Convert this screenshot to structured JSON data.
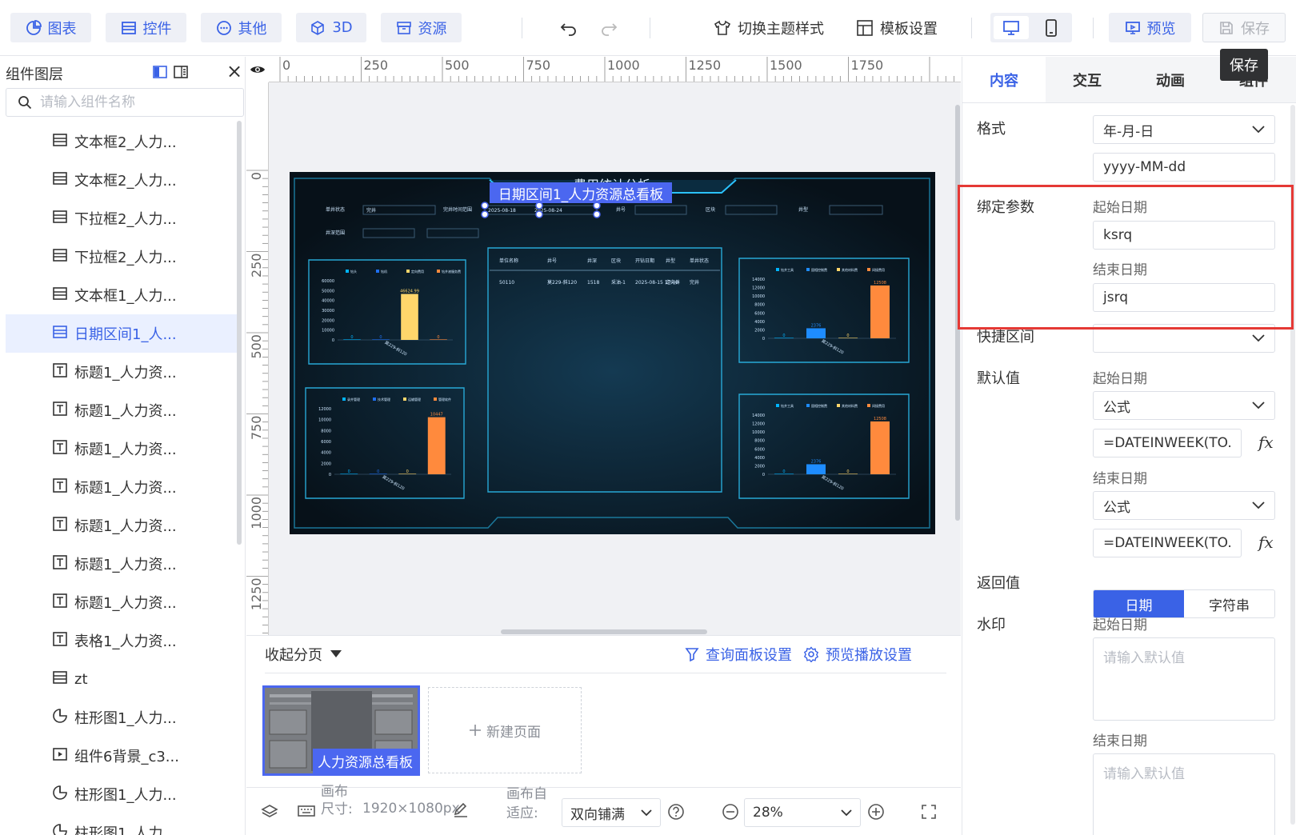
{
  "toolbar": {
    "chart_label": "图表",
    "widget_label": "控件",
    "other_label": "其他",
    "three_d_label": "3D",
    "resource_label": "资源",
    "theme_label": "切换主题样式",
    "template_label": "模板设置",
    "preview_label": "预览",
    "save_label": "保存",
    "save_tooltip": "保存"
  },
  "left_panel": {
    "title": "组件图层",
    "search_placeholder": "请输入组件名称",
    "items": [
      {
        "label": "文本框2_人力...",
        "icon": "textbox-icon"
      },
      {
        "label": "文本框2_人力...",
        "icon": "textbox-icon"
      },
      {
        "label": "下拉框2_人力...",
        "icon": "dropdown-icon"
      },
      {
        "label": "下拉框2_人力...",
        "icon": "dropdown-icon"
      },
      {
        "label": "文本框1_人力...",
        "icon": "textbox-icon"
      },
      {
        "label": "日期区间1_人...",
        "icon": "daterange-icon",
        "active": true
      },
      {
        "label": "标题1_人力资...",
        "icon": "title-icon"
      },
      {
        "label": "标题1_人力资...",
        "icon": "title-icon"
      },
      {
        "label": "标题1_人力资...",
        "icon": "title-icon"
      },
      {
        "label": "标题1_人力资...",
        "icon": "title-icon"
      },
      {
        "label": "标题1_人力资...",
        "icon": "title-icon"
      },
      {
        "label": "标题1_人力资...",
        "icon": "title-icon"
      },
      {
        "label": "标题1_人力资...",
        "icon": "title-icon"
      },
      {
        "label": "表格1_人力资...",
        "icon": "title-icon"
      },
      {
        "label": "zt",
        "icon": "textbox-icon"
      },
      {
        "label": "柱形图1_人力...",
        "icon": "pie-chart-icon"
      },
      {
        "label": "组件6背景_c3...",
        "icon": "play-icon"
      },
      {
        "label": "柱形图1_人力...",
        "icon": "pie-chart-icon"
      },
      {
        "label": "柱形图1_人力...",
        "icon": "pie-chart-icon"
      }
    ]
  },
  "canvas": {
    "ruler_h": [
      "0",
      "250",
      "500",
      "750",
      "1000",
      "1250",
      "1500",
      "1750"
    ],
    "ruler_v": [
      "0",
      "250",
      "500",
      "750",
      "1000",
      "1250"
    ],
    "selection_label": "日期区间1_人力资源总看板",
    "dashboard": {
      "title": "费用统计分析",
      "filters": {
        "f1": "单井状态",
        "f1v": "完井",
        "f2": "完井时间范围",
        "f2a": "2025-08-18",
        "f2b": "2025-08-24",
        "f3": "井号",
        "f4": "区块",
        "f5": "井型",
        "f6": "井深范围"
      },
      "table": {
        "headers": [
          "单位名称",
          "井号",
          "井深",
          "区块",
          "开钻日期",
          "井型",
          "单井状态"
        ],
        "row": [
          "50110",
          "莫229-斜120",
          "1518",
          "采油-1",
          "2025-08-15 17:00",
          "定向井",
          "完井"
        ]
      }
    }
  },
  "chart_data": [
    {
      "type": "bar",
      "categories": [
        "",
        "",
        "",
        ""
      ],
      "series": [
        {
          "values": [
            0,
            0,
            46624.99,
            0
          ]
        }
      ],
      "legend": [
        "钻头",
        "钻机",
        "定向费用",
        "钻井液服务费"
      ],
      "yticks": [
        "60000",
        "50000",
        "40000",
        "30000",
        "20000",
        "10000",
        "0"
      ],
      "ylim": [
        0,
        60000
      ],
      "xlabel": "莫229-斜120",
      "bar_labels": [
        "0",
        "0",
        "46624.99",
        "0"
      ],
      "colors": [
        "#00b4ff",
        "#1e6ff0",
        "#ffd66b",
        "#ff8a3d"
      ]
    },
    {
      "type": "bar",
      "categories": [
        "",
        "",
        "",
        ""
      ],
      "series": [
        {
          "values": [
            0,
            0,
            0,
            10447
          ]
        }
      ],
      "legend": [
        "录井管理",
        "技术管理",
        "运输管理",
        "管理软件"
      ],
      "yticks": [
        "12000",
        "10000",
        "8000",
        "6000",
        "4000",
        "2000",
        "0"
      ],
      "ylim": [
        0,
        12000
      ],
      "xlabel": "莫229-斜120",
      "bar_labels": [
        "0",
        "0",
        "0",
        "10447"
      ],
      "colors": [
        "#00b4ff",
        "#1e6ff0",
        "#ffd66b",
        "#ff8a3d"
      ]
    },
    {
      "type": "bar",
      "categories": [
        "",
        "",
        "",
        ""
      ],
      "series": [
        {
          "values": [
            0,
            2376,
            0,
            12508
          ]
        }
      ],
      "legend": [
        "钻井工具",
        "固相控制费",
        "其他材料费",
        "间接费用"
      ],
      "yticks": [
        "14000",
        "12000",
        "10000",
        "8000",
        "6000",
        "4000",
        "2000",
        "0"
      ],
      "ylim": [
        0,
        14000
      ],
      "xlabel": "莫229-斜120",
      "bar_labels": [
        "0",
        "2376",
        "0",
        "12508"
      ],
      "colors": [
        "#00b4ff",
        "#1e8cff",
        "#ffd66b",
        "#ff8a3d"
      ]
    },
    {
      "type": "bar",
      "categories": [
        "",
        "",
        "",
        ""
      ],
      "series": [
        {
          "values": [
            0,
            2376,
            0,
            12508
          ]
        }
      ],
      "legend": [
        "钻井工具",
        "固相控制费",
        "其他材料费",
        "间接费用"
      ],
      "yticks": [
        "14000",
        "12000",
        "10000",
        "8000",
        "6000",
        "4000",
        "2000",
        "0"
      ],
      "ylim": [
        0,
        14000
      ],
      "xlabel": "莫229-斜120",
      "bar_labels": [
        "0",
        "2376",
        "0",
        "12508"
      ],
      "colors": [
        "#00b4ff",
        "#1e8cff",
        "#ffd66b",
        "#ff8a3d"
      ]
    }
  ],
  "pages": {
    "collapse_label": "收起分页",
    "query_settings": "查询面板设置",
    "preview_settings": "预览播放设置",
    "page_name": "人力资源总看板",
    "new_page": "新建页面"
  },
  "statusbar": {
    "canvas_size_label": "画布尺寸:",
    "canvas_size": "1920×1080px",
    "fit_label": "画布自适应:",
    "fit_value": "双向铺满",
    "zoom": "28%"
  },
  "right_panel": {
    "tabs": [
      "内容",
      "交互",
      "动画",
      "组件"
    ],
    "format_label": "格式",
    "format_value": "年-月-日",
    "format_pattern": "yyyy-MM-dd",
    "bind_label": "绑定参数",
    "start_date_label": "起始日期",
    "start_param": "ksrq",
    "end_date_label": "结束日期",
    "end_param": "jsrq",
    "quick_label": "快捷区间",
    "default_label": "默认值",
    "default_start_type": "公式",
    "default_start_formula": "=DATEINWEEK(TO...",
    "default_end_type": "公式",
    "default_end_formula": "=DATEINWEEK(TO...",
    "fx": "fx",
    "return_label": "返回值",
    "return_date": "日期",
    "return_string": "字符串",
    "watermark_label": "水印",
    "watermark_placeholder": "请输入默认值"
  }
}
